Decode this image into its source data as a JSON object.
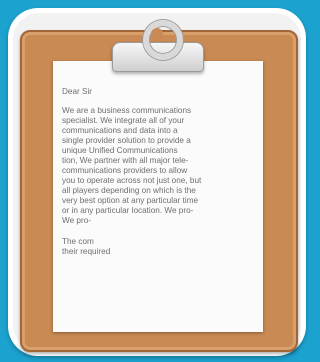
{
  "letter": {
    "greeting": "Dear Sir",
    "paragraph1_lines": [
      "We are a business communications",
      "specialist. We integrate all of your",
      "communications and data into a",
      "single provider solution to provide a",
      "unique Unified Communications",
      "tion, We partner with all major tele-",
      "communications providers to allow",
      "you to operate across not just one, but",
      "all players  depending on which is the",
      "very best option at any particular time",
      "or in any particular location. We pro-",
      " We pro-"
    ],
    "paragraph2_lines": [
      "The com",
      "their required"
    ]
  },
  "colors": {
    "background": "#1ca2cf",
    "board": "#c98a53",
    "paper": "#fbfbfb",
    "text": "#6e6e6e"
  },
  "icons": {
    "clip": "clipboard-clip-icon"
  }
}
